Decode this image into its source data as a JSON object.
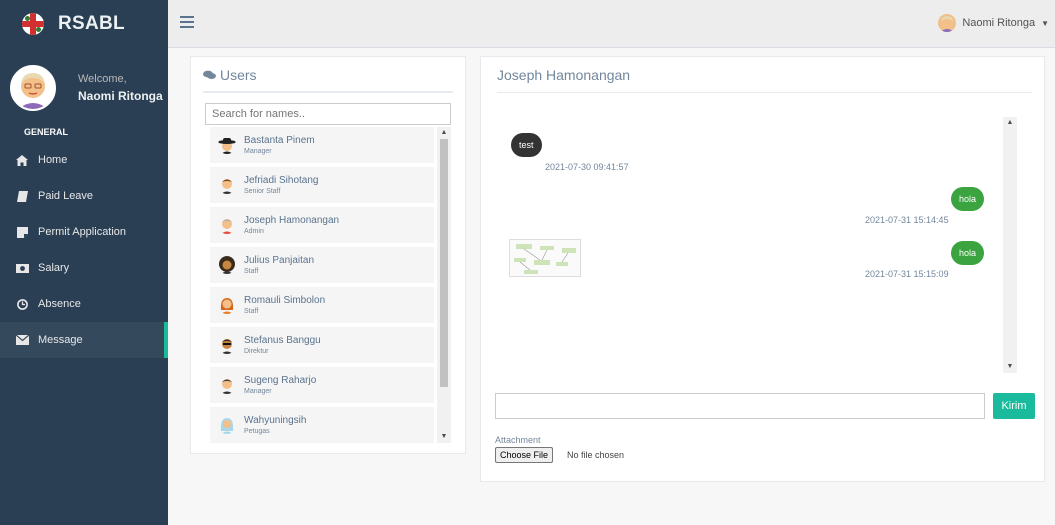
{
  "brand": {
    "name": "RSABL"
  },
  "profile": {
    "welcome": "Welcome,",
    "name": "Naomi Ritonga"
  },
  "sidebar": {
    "section": "GENERAL",
    "items": [
      {
        "label": "Home",
        "icon": "home-icon"
      },
      {
        "label": "Paid Leave",
        "icon": "book-icon"
      },
      {
        "label": "Permit Application",
        "icon": "document-icon"
      },
      {
        "label": "Salary",
        "icon": "money-icon"
      },
      {
        "label": "Absence",
        "icon": "clock-icon"
      },
      {
        "label": "Message",
        "icon": "envelope-icon",
        "active": true
      }
    ]
  },
  "topbar": {
    "user_name": "Naomi Ritonga"
  },
  "users_panel": {
    "title": "Users",
    "search_placeholder": "Search for names..",
    "users": [
      {
        "name": "Bastanta Pinem",
        "role": "Manager"
      },
      {
        "name": "Jefriadi Sihotang",
        "role": "Senior Staff"
      },
      {
        "name": "Joseph Hamonangan",
        "role": "Admin"
      },
      {
        "name": "Julius Panjaitan",
        "role": "Staff"
      },
      {
        "name": "Romauli Simbolon",
        "role": "Staff"
      },
      {
        "name": "Stefanus Banggu",
        "role": "Direktur"
      },
      {
        "name": "Sugeng Raharjo",
        "role": "Manager"
      },
      {
        "name": "Wahyuningsih",
        "role": "Petugas"
      }
    ]
  },
  "chat": {
    "title": "Joseph Hamonangan",
    "messages": [
      {
        "text": "test",
        "time": "2021-07-30 09:41:57",
        "side": "left"
      },
      {
        "text": "hola",
        "time": "2021-07-31 15:14:45",
        "side": "right"
      },
      {
        "text": "hola",
        "time": "2021-07-31 15:15:09",
        "side": "right"
      }
    ],
    "send_label": "Kirim",
    "attachment_label": "Attachment",
    "choose_file_label": "Choose File",
    "no_file_label": "No file chosen"
  },
  "colors": {
    "sidebar": "#2a3f54",
    "accent": "#1abb9c",
    "bubble_green": "#3ba33f",
    "bubble_dark": "#333333"
  }
}
